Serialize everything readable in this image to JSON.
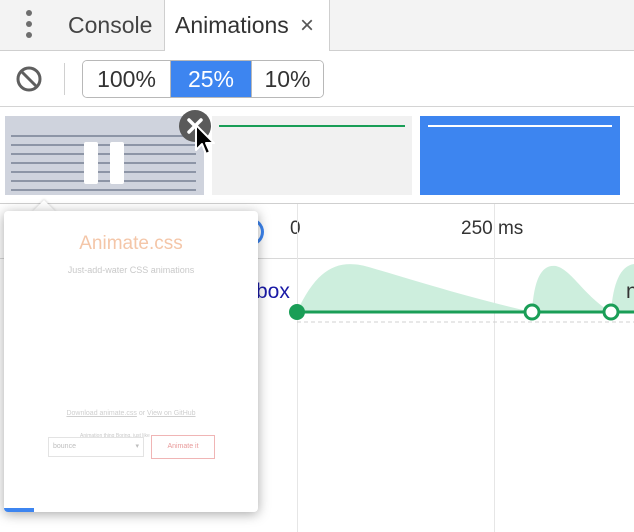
{
  "tabs": {
    "console_label": "Console",
    "animations_label": "Animations",
    "close_glyph": "×"
  },
  "toolbar": {
    "clear_icon": "block-icon",
    "speeds": [
      "100%",
      "25%",
      "10%"
    ],
    "selected_speed": "25%"
  },
  "colors": {
    "accent": "#3d85f0",
    "keyframe_green": "#1a9e57",
    "curve_fill": "#cdeedd"
  },
  "timeline": {
    "tick_0": "0",
    "tick_250": "250 ms",
    "node_label": "box",
    "node_label_2": "n"
  },
  "preview": {
    "title": "Animate.css",
    "subtitle": "Just-add-water CSS animations",
    "link_download": "Download animate.css",
    "link_or": "or",
    "link_github": "View on GitHub",
    "select_caption": "Animation thing Boring, just like",
    "select_value": "bounce",
    "button_label": "Animate it"
  }
}
